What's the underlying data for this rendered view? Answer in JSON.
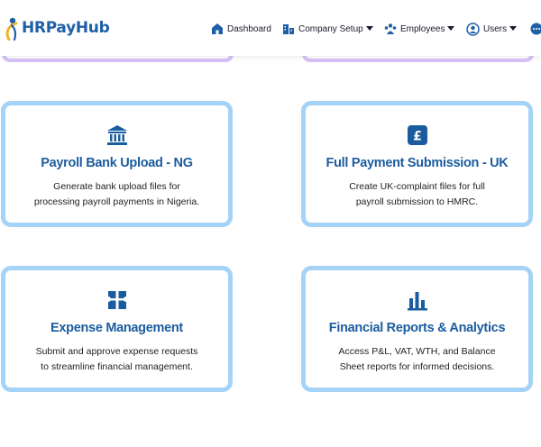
{
  "brand": {
    "name": "HRPayHub",
    "color": "#1f5fa6",
    "accent": "#f0b429"
  },
  "nav": {
    "dashboard": "Dashboard",
    "company_setup": "Company Setup",
    "employees": "Employees",
    "users": "Users"
  },
  "cards": [
    {
      "icon": "bank-icon",
      "title": "Payroll Bank Upload - NG",
      "desc_line1": "Generate bank upload files for",
      "desc_line2": "processing payroll payments in Nigeria."
    },
    {
      "icon": "pound-icon",
      "title": "Full Payment Submission - UK",
      "desc_line1": "Create UK-complaint files for full",
      "desc_line2": "payroll submission to HMRC."
    },
    {
      "icon": "receipt-icon",
      "title": "Expense Management",
      "desc_line1": "Submit and approve expense requests",
      "desc_line2": "to streamline financial management."
    },
    {
      "icon": "bar-chart-icon",
      "title": "Financial Reports & Analytics",
      "desc_line1": "Access P&L, VAT, WTH, and Balance",
      "desc_line2": "Sheet reports for informed decisions."
    }
  ],
  "colors": {
    "card_border": "#a5d3f7",
    "stub_border": "#d7c2f7",
    "title": "#1b5c9e"
  }
}
